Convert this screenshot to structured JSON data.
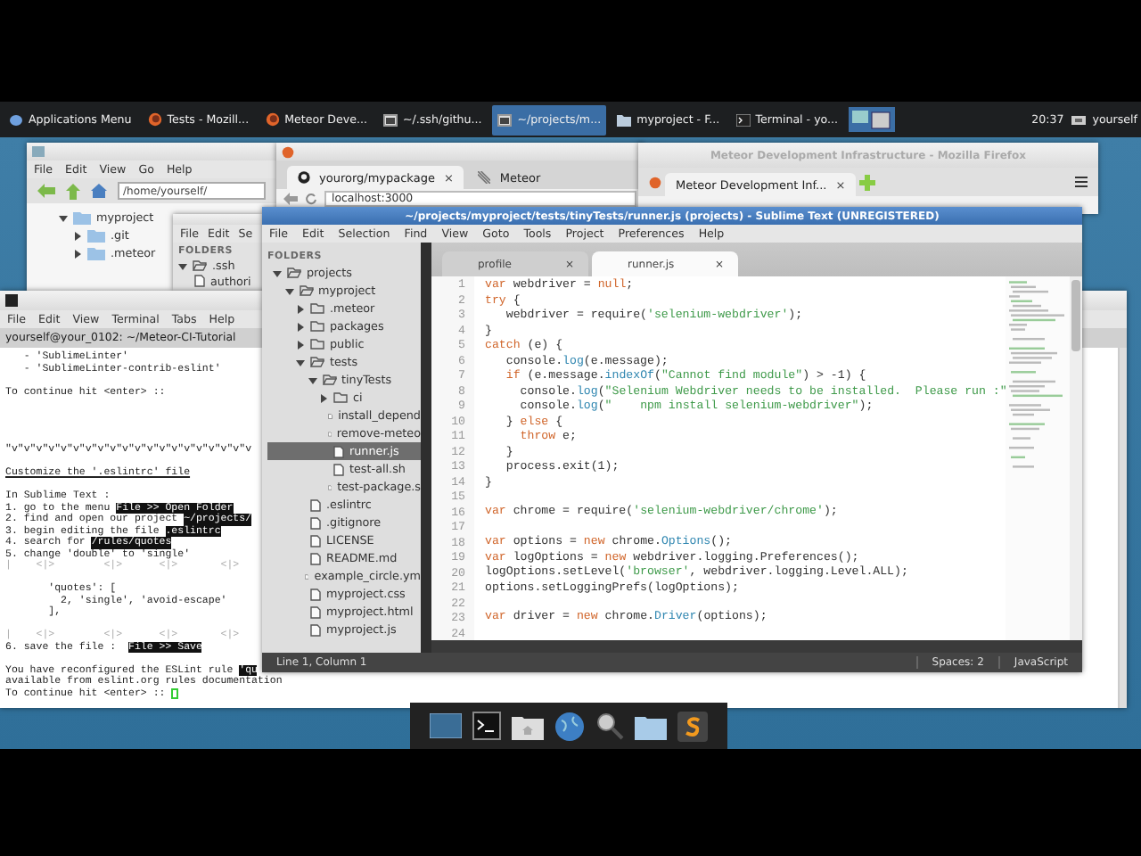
{
  "taskbar": {
    "menu_label": "Applications Menu",
    "tasks": [
      {
        "label": "Tests - Mozill...",
        "kind": "browser",
        "selected": false
      },
      {
        "label": "Meteor Deve...",
        "kind": "browser",
        "selected": false
      },
      {
        "label": "~/.ssh/githu...",
        "kind": "editor",
        "selected": false
      },
      {
        "label": "~/projects/m...",
        "kind": "editor",
        "selected": true
      },
      {
        "label": "myproject - F...",
        "kind": "folder",
        "selected": false
      },
      {
        "label": "Terminal - yo...",
        "kind": "terminal",
        "selected": false
      }
    ],
    "clock": "20:37",
    "user": "yourself"
  },
  "file_manager": {
    "menu": [
      "File",
      "Edit",
      "View",
      "Go",
      "Help"
    ],
    "path": "/home/yourself/",
    "tree": [
      {
        "label": "myproject",
        "expanded": true,
        "children": [
          {
            "label": ".git",
            "expanded": false
          },
          {
            "label": ".meteor",
            "expanded": false
          }
        ]
      }
    ]
  },
  "ssh_editor": {
    "menu": [
      "File",
      "Edit",
      "Se"
    ],
    "sidebar_header": "FOLDERS",
    "tree": [
      {
        "label": ".ssh",
        "kind": "folder",
        "expanded": true,
        "children": [
          {
            "label": "authori",
            "kind": "file"
          }
        ]
      }
    ]
  },
  "browser_tests": {
    "tabs": [
      {
        "label": "yourorg/mypackage",
        "selected": true,
        "close": "×"
      },
      {
        "label": "Meteor",
        "selected": false
      }
    ],
    "url": "localhost:3000"
  },
  "browser_meteor": {
    "title": "Meteor Development Infrastructure - Mozilla Firefox",
    "tabs": [
      {
        "label": "Meteor Development Inf...",
        "selected": true,
        "close": "×"
      }
    ]
  },
  "terminal": {
    "menu": [
      "File",
      "Edit",
      "View",
      "Terminal",
      "Tabs",
      "Help"
    ],
    "tab_title": "yourself@your_0102: ~/Meteor-CI-Tutorial",
    "lines": [
      {
        "kind": "text",
        "segments": [
          {
            "text": "   - 'SublimeLinter'",
            "kind": "plain"
          }
        ]
      },
      {
        "kind": "text",
        "segments": [
          {
            "text": "   - 'SublimeLinter-contrib-eslint'",
            "kind": "plain"
          }
        ]
      },
      {
        "kind": "blank"
      },
      {
        "kind": "text",
        "segments": [
          {
            "text": "To continue hit <enter> ::",
            "kind": "plain"
          }
        ]
      },
      {
        "kind": "blank"
      },
      {
        "kind": "blank"
      },
      {
        "kind": "blank"
      },
      {
        "kind": "blank"
      },
      {
        "kind": "text",
        "segments": [
          {
            "text": "\"v\"v\"v\"v\"v\"v\"v\"v\"v\"v\"v\"v\"v\"v\"v\"v\"v\"v\"v\"v",
            "kind": "plain"
          }
        ]
      },
      {
        "kind": "blank"
      },
      {
        "kind": "text",
        "segments": [
          {
            "text": "Customize the '.eslintrc' file",
            "kind": "underline"
          }
        ]
      },
      {
        "kind": "blank"
      },
      {
        "kind": "text",
        "segments": [
          {
            "text": "In Sublime Text :",
            "kind": "plain"
          }
        ]
      },
      {
        "kind": "text",
        "segments": [
          {
            "text": "1. go to the menu ",
            "kind": "plain"
          },
          {
            "text": "File >> Open Folder",
            "kind": "highlight"
          }
        ]
      },
      {
        "kind": "text",
        "segments": [
          {
            "text": "2. find and open our project ",
            "kind": "plain"
          },
          {
            "text": "~/projects/",
            "kind": "highlight"
          }
        ]
      },
      {
        "kind": "text",
        "segments": [
          {
            "text": "3. begin editing the file ",
            "kind": "plain"
          },
          {
            "text": ".eslintrc",
            "kind": "highlight"
          }
        ]
      },
      {
        "kind": "text",
        "segments": [
          {
            "text": "4. search for ",
            "kind": "plain"
          },
          {
            "text": "/rules/quotes",
            "kind": "highlight"
          }
        ]
      },
      {
        "kind": "text",
        "segments": [
          {
            "text": "5. change 'double' to 'single'",
            "kind": "plain"
          }
        ]
      },
      {
        "kind": "text",
        "segments": [
          {
            "text": "|    <|>        <|>      <|>       <|>",
            "kind": "faint"
          }
        ]
      },
      {
        "kind": "blank"
      },
      {
        "kind": "text",
        "segments": [
          {
            "text": "       'quotes': [",
            "kind": "plain"
          }
        ]
      },
      {
        "kind": "text",
        "segments": [
          {
            "text": "         2, 'single', 'avoid-escape'",
            "kind": "plain"
          }
        ]
      },
      {
        "kind": "text",
        "segments": [
          {
            "text": "       ],",
            "kind": "plain"
          }
        ]
      },
      {
        "kind": "blank"
      },
      {
        "kind": "text",
        "segments": [
          {
            "text": "|    <|>        <|>      <|>       <|>",
            "kind": "faint"
          }
        ]
      },
      {
        "kind": "text",
        "segments": [
          {
            "text": "6. save the file :  ",
            "kind": "plain"
          },
          {
            "text": "File >> Save",
            "kind": "highlight"
          }
        ]
      },
      {
        "kind": "blank"
      },
      {
        "kind": "text",
        "segments": [
          {
            "text": "You have reconfigured the ESLint rule ",
            "kind": "plain"
          },
          {
            "text": "'qu",
            "kind": "highlight"
          }
        ]
      },
      {
        "kind": "text",
        "segments": [
          {
            "text": "available from eslint.org rules documentation",
            "kind": "plain"
          }
        ]
      },
      {
        "kind": "text",
        "cursor": true,
        "segments": [
          {
            "text": "To continue hit <enter> :: ",
            "kind": "plain"
          }
        ]
      }
    ]
  },
  "sublime": {
    "title": "~/projects/myproject/tests/tinyTests/runner.js (projects) - Sublime Text (UNREGISTERED)",
    "menu": [
      "File",
      "Edit",
      "Selection",
      "Find",
      "View",
      "Goto",
      "Tools",
      "Project",
      "Preferences",
      "Help"
    ],
    "sidebar_header": "FOLDERS",
    "tree": [
      {
        "label": "projects",
        "kind": "folder",
        "expanded": true,
        "selected": false,
        "children": [
          {
            "label": "myproject",
            "kind": "folder",
            "expanded": true,
            "selected": false,
            "children": [
              {
                "label": ".meteor",
                "kind": "folder",
                "expanded": false,
                "selected": false
              },
              {
                "label": "packages",
                "kind": "folder",
                "expanded": false,
                "selected": false
              },
              {
                "label": "public",
                "kind": "folder",
                "expanded": false,
                "selected": false
              },
              {
                "label": "tests",
                "kind": "folder",
                "expanded": true,
                "selected": false,
                "children": [
                  {
                    "label": "tinyTests",
                    "kind": "folder",
                    "expanded": true,
                    "selected": false,
                    "children": [
                      {
                        "label": "ci",
                        "kind": "folder",
                        "expanded": false,
                        "selected": false
                      },
                      {
                        "label": "install_depend",
                        "kind": "file",
                        "selected": false
                      },
                      {
                        "label": "remove-meteo",
                        "kind": "file",
                        "selected": false
                      },
                      {
                        "label": "runner.js",
                        "kind": "file",
                        "selected": true
                      },
                      {
                        "label": "test-all.sh",
                        "kind": "file",
                        "selected": false
                      },
                      {
                        "label": "test-package.s",
                        "kind": "file",
                        "selected": false
                      }
                    ]
                  }
                ]
              },
              {
                "label": ".eslintrc",
                "kind": "file",
                "selected": false
              },
              {
                "label": ".gitignore",
                "kind": "file",
                "selected": false
              },
              {
                "label": "LICENSE",
                "kind": "file",
                "selected": false
              },
              {
                "label": "README.md",
                "kind": "file",
                "selected": false
              },
              {
                "label": "example_circle.ym",
                "kind": "file",
                "selected": false
              },
              {
                "label": "myproject.css",
                "kind": "file",
                "selected": false
              },
              {
                "label": "myproject.html",
                "kind": "file",
                "selected": false
              },
              {
                "label": "myproject.js",
                "kind": "file",
                "selected": false
              }
            ]
          }
        ]
      }
    ],
    "tabs": [
      {
        "label": "profile",
        "selected": false,
        "close": "×"
      },
      {
        "label": "runner.js",
        "selected": true,
        "close": "×"
      }
    ],
    "code": [
      {
        "number": "1",
        "tokens": [
          {
            "text": "var",
            "kind": "kw"
          },
          {
            "text": " webdriver = ",
            "kind": "tx"
          },
          {
            "text": "null",
            "kind": "kw"
          },
          {
            "text": ";",
            "kind": "tx"
          }
        ]
      },
      {
        "number": "2",
        "tokens": [
          {
            "text": "try",
            "kind": "kw"
          },
          {
            "text": " {",
            "kind": "tx"
          }
        ]
      },
      {
        "number": "3",
        "tokens": [
          {
            "text": "   webdriver = require(",
            "kind": "tx"
          },
          {
            "text": "'selenium-webdriver'",
            "kind": "str"
          },
          {
            "text": ");",
            "kind": "tx"
          }
        ]
      },
      {
        "number": "4",
        "tokens": [
          {
            "text": "}",
            "kind": "tx"
          }
        ]
      },
      {
        "number": "5",
        "tokens": [
          {
            "text": "catch",
            "kind": "kw"
          },
          {
            "text": " (e) {",
            "kind": "tx"
          }
        ]
      },
      {
        "number": "6",
        "tokens": [
          {
            "text": "   console.",
            "kind": "tx"
          },
          {
            "text": "log",
            "kind": "fn"
          },
          {
            "text": "(e.message);",
            "kind": "tx"
          }
        ]
      },
      {
        "number": "7",
        "tokens": [
          {
            "text": "   if",
            "kind": "kw"
          },
          {
            "text": " (e.message.",
            "kind": "tx"
          },
          {
            "text": "indexOf",
            "kind": "fn"
          },
          {
            "text": "(",
            "kind": "tx"
          },
          {
            "text": "\"Cannot find module\"",
            "kind": "str"
          },
          {
            "text": ") > -1) {",
            "kind": "tx"
          }
        ]
      },
      {
        "number": "8",
        "tokens": [
          {
            "text": "     console.",
            "kind": "tx"
          },
          {
            "text": "log",
            "kind": "fn"
          },
          {
            "text": "(",
            "kind": "tx"
          },
          {
            "text": "\"Selenium Webdriver needs to be installed.  Please run :\"",
            "kind": "str"
          }
        ]
      },
      {
        "number": "9",
        "tokens": [
          {
            "text": "     console.",
            "kind": "tx"
          },
          {
            "text": "log",
            "kind": "fn"
          },
          {
            "text": "(",
            "kind": "tx"
          },
          {
            "text": "\"    npm install selenium-webdriver\"",
            "kind": "str"
          },
          {
            "text": ");",
            "kind": "tx"
          }
        ]
      },
      {
        "number": "10",
        "tokens": [
          {
            "text": "   } ",
            "kind": "tx"
          },
          {
            "text": "else",
            "kind": "kw"
          },
          {
            "text": " {",
            "kind": "tx"
          }
        ]
      },
      {
        "number": "11",
        "tokens": [
          {
            "text": "     throw",
            "kind": "kw"
          },
          {
            "text": " e;",
            "kind": "tx"
          }
        ]
      },
      {
        "number": "12",
        "tokens": [
          {
            "text": "   }",
            "kind": "tx"
          }
        ]
      },
      {
        "number": "13",
        "tokens": [
          {
            "text": "   process.exit(1);",
            "kind": "tx"
          }
        ]
      },
      {
        "number": "14",
        "tokens": [
          {
            "text": "}",
            "kind": "tx"
          }
        ]
      },
      {
        "number": "15"
      },
      {
        "number": "16",
        "tokens": [
          {
            "text": "var",
            "kind": "kw"
          },
          {
            "text": " chrome = require(",
            "kind": "tx"
          },
          {
            "text": "'selenium-webdriver/chrome'",
            "kind": "str"
          },
          {
            "text": ");",
            "kind": "tx"
          }
        ]
      },
      {
        "number": "17"
      },
      {
        "number": "18",
        "tokens": [
          {
            "text": "var",
            "kind": "kw"
          },
          {
            "text": " options = ",
            "kind": "tx"
          },
          {
            "text": "new",
            "kind": "kw"
          },
          {
            "text": " chrome.",
            "kind": "tx"
          },
          {
            "text": "Options",
            "kind": "fn"
          },
          {
            "text": "();",
            "kind": "tx"
          }
        ]
      },
      {
        "number": "19",
        "tokens": [
          {
            "text": "var",
            "kind": "kw"
          },
          {
            "text": " logOptions = ",
            "kind": "tx"
          },
          {
            "text": "new",
            "kind": "kw"
          },
          {
            "text": " webdriver.logging.Preferences();",
            "kind": "tx"
          }
        ]
      },
      {
        "number": "20",
        "tokens": [
          {
            "text": "logOptions.setLevel(",
            "kind": "tx"
          },
          {
            "text": "'browser'",
            "kind": "str"
          },
          {
            "text": ", webdriver.logging.Level.ALL);",
            "kind": "tx"
          }
        ]
      },
      {
        "number": "21",
        "tokens": [
          {
            "text": "options.setLoggingPrefs(logOptions);",
            "kind": "tx"
          }
        ]
      },
      {
        "number": "22"
      },
      {
        "number": "23",
        "tokens": [
          {
            "text": "var",
            "kind": "kw"
          },
          {
            "text": " driver = ",
            "kind": "tx"
          },
          {
            "text": "new",
            "kind": "kw"
          },
          {
            "text": " chrome.",
            "kind": "tx"
          },
          {
            "text": "Driver",
            "kind": "fn"
          },
          {
            "text": "(options);",
            "kind": "tx"
          }
        ]
      },
      {
        "number": "24"
      }
    ],
    "status": {
      "position": "Line 1, Column 1",
      "indent": "Spaces: 2",
      "syntax": "JavaScript"
    }
  }
}
